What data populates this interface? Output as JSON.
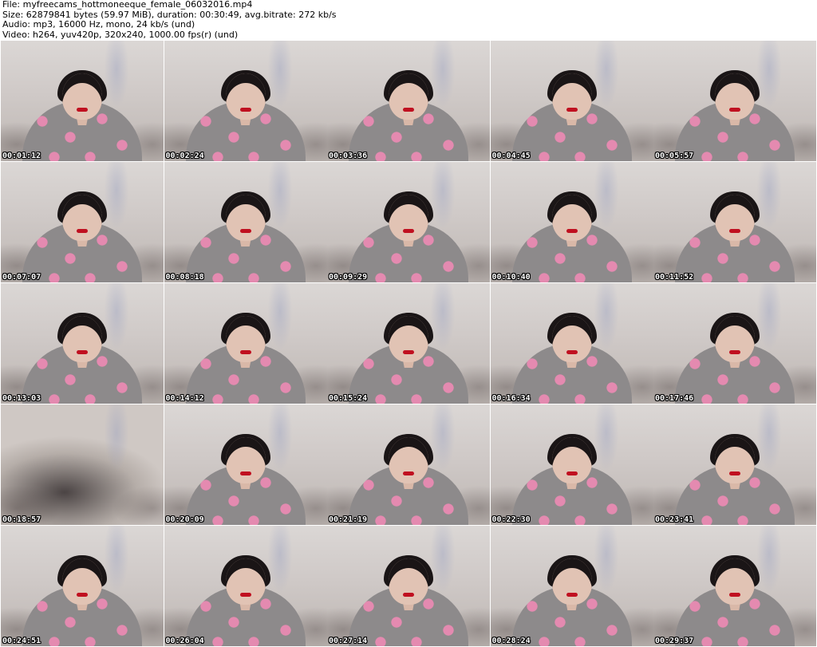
{
  "header": {
    "file": "File: myfreecams_hottmoneeque_female_06032016.mp4",
    "size": "Size: 62879841 bytes (59.97 MiB), duration: 00:30:49, avg.bitrate: 272 kb/s",
    "audio": "Audio: mp3, 16000 Hz, mono, 24 kb/s (und)",
    "video": "Video: h264, yuv420p, 320x240, 1000.00 fps(r) (und)"
  },
  "thumbnails": [
    {
      "timestamp": "00:01:12"
    },
    {
      "timestamp": "00:02:24"
    },
    {
      "timestamp": "00:03:36"
    },
    {
      "timestamp": "00:04:45"
    },
    {
      "timestamp": "00:05:57"
    },
    {
      "timestamp": "00:07:07"
    },
    {
      "timestamp": "00:08:18"
    },
    {
      "timestamp": "00:09:29"
    },
    {
      "timestamp": "00:10:40"
    },
    {
      "timestamp": "00:11:52"
    },
    {
      "timestamp": "00:13:03"
    },
    {
      "timestamp": "00:14:12"
    },
    {
      "timestamp": "00:15:24"
    },
    {
      "timestamp": "00:16:34"
    },
    {
      "timestamp": "00:17:46"
    },
    {
      "timestamp": "00:18:57"
    },
    {
      "timestamp": "00:20:09"
    },
    {
      "timestamp": "00:21:19"
    },
    {
      "timestamp": "00:22:30"
    },
    {
      "timestamp": "00:23:41"
    },
    {
      "timestamp": "00:24:51"
    },
    {
      "timestamp": "00:26:04"
    },
    {
      "timestamp": "00:27:14"
    },
    {
      "timestamp": "00:28:24"
    },
    {
      "timestamp": "00:29:37"
    }
  ]
}
